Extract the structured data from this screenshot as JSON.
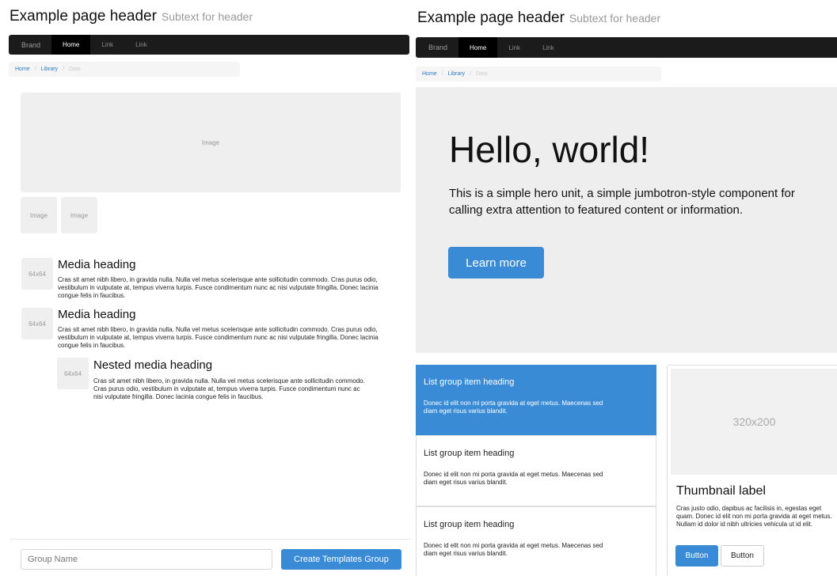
{
  "left": {
    "header": {
      "title": "Example page header",
      "subtext": "Subtext for header"
    },
    "navbar": {
      "brand": "Brand",
      "items": [
        "Home",
        "Link",
        "Link"
      ]
    },
    "breadcrumb": [
      "Home",
      "Library",
      "Data"
    ],
    "image_main": "Image",
    "image_small": [
      "Image",
      "Image"
    ],
    "media": [
      {
        "thumb": "64x64",
        "heading": "Media heading",
        "body": "Cras sit amet nibh libero, in gravida nulla. Nulla vel metus scelerisque ante sollicitudin commodo. Cras purus odio, vestibulum in vulputate at, tempus viverra turpis. Fusce condimentum nunc ac nisi vulputate fringilla. Donec lacinia congue felis in faucibus."
      },
      {
        "thumb": "64x64",
        "heading": "Media heading",
        "body": "Cras sit amet nibh libero, in gravida nulla. Nulla vel metus scelerisque ante sollicitudin commodo. Cras purus odio, vestibulum in vulputate at, tempus viverra turpis. Fusce condimentum nunc ac nisi vulputate fringilla. Donec lacinia congue felis in faucibus."
      }
    ],
    "nested": {
      "thumb": "64x64",
      "heading": "Nested media heading",
      "body": "Cras sit amet nibh libero, in gravida nulla. Nulla vel metus scelerisque ante sollicitudin commodo. Cras purus odio, vestibulum in vulputate at, tempus viverra turpis. Fusce condimentum nunc ac nisi vulputate fringilla. Donec lacinia congue felis in faucibus."
    },
    "footer": {
      "placeholder": "Group Name",
      "button": "Create Templates Group"
    }
  },
  "right": {
    "header": {
      "title": "Example page header",
      "subtext": "Subtext for header"
    },
    "navbar": {
      "brand": "Brand",
      "items": [
        "Home",
        "Link",
        "Link"
      ]
    },
    "breadcrumb": [
      "Home",
      "Library",
      "Data"
    ],
    "jumbotron": {
      "title": "Hello, world!",
      "text": "This is a simple hero unit, a simple jumbotron-style component for calling extra attention to featured content or information.",
      "button": "Learn more"
    },
    "list_group": [
      {
        "heading": "List group item heading",
        "text": "Donec id elit non mi porta gravida at eget metus. Maecenas sed diam eget risus varius blandit."
      },
      {
        "heading": "List group item heading",
        "text": "Donec id elit non mi porta gravida at eget metus. Maecenas sed diam eget risus varius blandit."
      },
      {
        "heading": "List group item heading",
        "text": "Donec id elit non mi porta gravida at eget metus. Maecenas sed diam eget risus varius blandit."
      }
    ],
    "thumbnail": {
      "image": "320x200",
      "label": "Thumbnail label",
      "text": "Cras justo odio, dapibus ac facilisis in, egestas eget quam. Donec id elit non mi porta gravida at eget metus. Nullam id dolor id nibh ultricies vehicula ut id elit.",
      "button_primary": "Button",
      "button_default": "Button"
    }
  },
  "colors": {
    "primary": "#3a8bd6",
    "navbar": "#1b1b1b",
    "placeholder": "#efefef"
  }
}
